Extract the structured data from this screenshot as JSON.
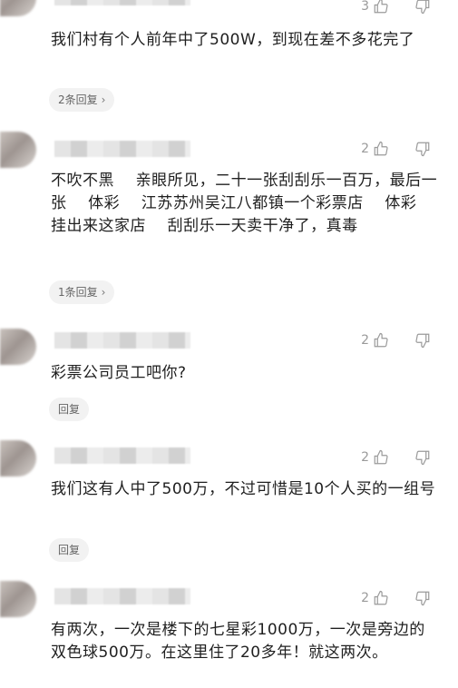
{
  "comments": [
    {
      "likes": "3",
      "text": "我们村有个人前年中了500W，到现在差不多花完了",
      "reply_label": "2条回复",
      "reply_chevron": "›"
    },
    {
      "likes": "2",
      "text": "不吹不黑    亲眼所见，二十一张刮刮乐一百万，最后一张    体彩    江苏苏州吴江八都镇一个彩票店    体彩      挂出来这家店    刮刮乐一天卖干净了，真毒",
      "reply_label": "1条回复",
      "reply_chevron": "›"
    },
    {
      "likes": "2",
      "text": "彩票公司员工吧你?",
      "reply_label": "回复"
    },
    {
      "likes": "2",
      "text": "我们这有人中了500万，不过可惜是10个人买的一组号",
      "reply_label": "回复"
    },
    {
      "likes": "2",
      "text": "有两次，一次是楼下的七星彩1000万，一次是旁边的双色球500万。在这里住了20多年！就这两次。"
    }
  ],
  "icons": {
    "like": "thumb-up-icon",
    "dislike": "thumb-down-icon"
  }
}
